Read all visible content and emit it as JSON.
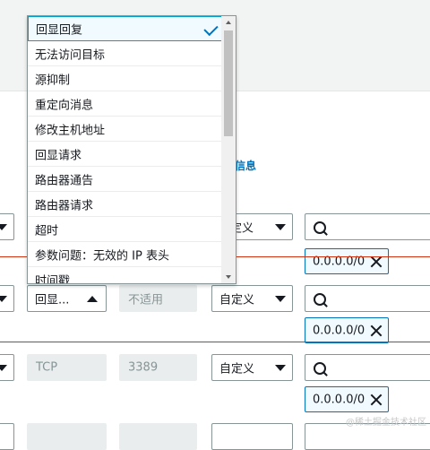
{
  "background": {
    "band_text": ""
  },
  "info_link": "信息",
  "dropdown": {
    "options": [
      "回显回复",
      "无法访问目标",
      "源抑制",
      "重定向消息",
      "修改主机地址",
      "回显请求",
      "路由器通告",
      "路由器请求",
      "超时",
      "参数问题：无效的 IP 表头",
      "时间戳"
    ],
    "selected": "回显回复"
  },
  "rows": {
    "row1": {
      "source_type": "定义"
    },
    "row2": {
      "protocol": "回显...",
      "port_range": "不适用",
      "source_type": "自定义"
    },
    "row3": {
      "protocol": "TCP",
      "port_range": "3389",
      "source_type": "自定义"
    }
  },
  "cidr_tokens": [
    "0.0.0.0/0",
    "0.0.0.0/0",
    "0.0.0.0/0"
  ],
  "watermark": "@稀土掘金技术社区",
  "colors": {
    "accent": "#0073bb",
    "red_line": "#d13212"
  }
}
